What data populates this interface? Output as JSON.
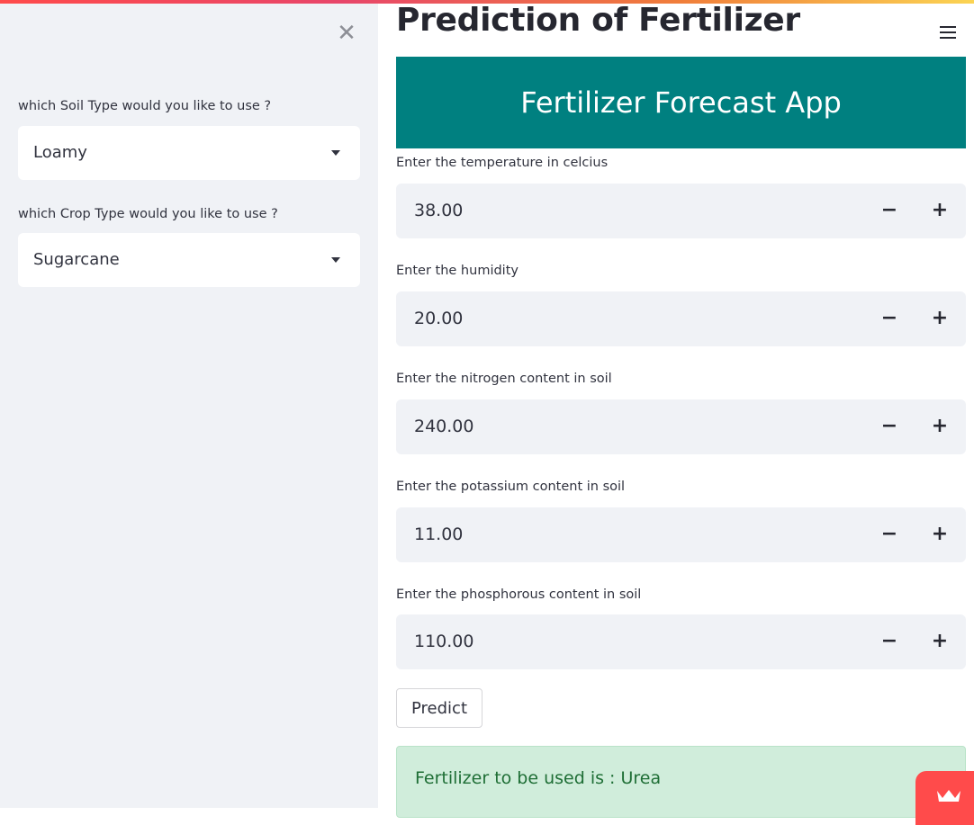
{
  "sidebar": {
    "close_glyph": "✕",
    "soil": {
      "label": "which Soil Type would you like to use ?",
      "value": "Loamy"
    },
    "crop": {
      "label": "which Crop Type would you like to use ?",
      "value": "Sugarcane"
    }
  },
  "main": {
    "title": "Prediction of Fertilizer",
    "banner": "Fertilizer Forecast App",
    "fields": [
      {
        "label": "Enter the temperature in celcius",
        "value": "38.00"
      },
      {
        "label": "Enter the humidity",
        "value": "20.00"
      },
      {
        "label": "Enter the nitrogen content in soil",
        "value": "240.00"
      },
      {
        "label": "Enter the potassium content in soil",
        "value": "11.00"
      },
      {
        "label": "Enter the phosphorous content in soil",
        "value": "110.00"
      }
    ],
    "stepper": {
      "minus": "−",
      "plus": "+"
    },
    "predict_label": "Predict",
    "result_text": "Fertilizer to be used is : Urea"
  },
  "icons": {
    "close": "close-icon",
    "menu": "hamburger-menu-icon",
    "dropdown": "caret-down-icon",
    "badge": "crown-icon"
  },
  "colors": {
    "accent": "#ff4b4b",
    "banner": "#008080",
    "sidebar_bg": "#f0f2f6",
    "success_bg": "#d0eddb",
    "success_text": "#1e6e35"
  }
}
